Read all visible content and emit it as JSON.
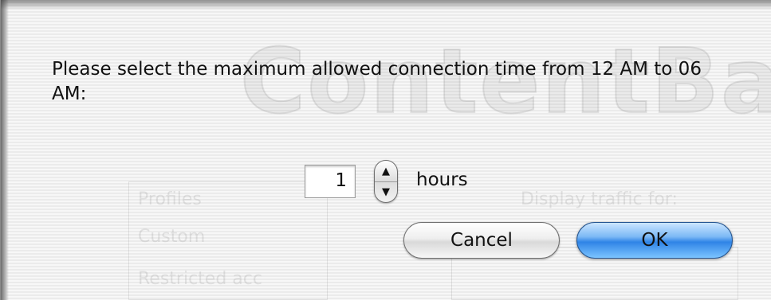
{
  "dialog": {
    "message": "Please select the maximum allowed connection time from 12 AM to 06 AM:",
    "time_value": "1",
    "unit_label": "hours",
    "cancel_label": "Cancel",
    "ok_label": "OK"
  },
  "background_window": {
    "logo_text": "ContentBa",
    "profiles_label": "Profiles",
    "profile_items": [
      "Custom",
      "Restricted acc"
    ],
    "traffic_label": "Display traffic for:"
  },
  "colors": {
    "ok_button_accent": "#2f84e6",
    "sheet_background": "#f4f4f4"
  }
}
